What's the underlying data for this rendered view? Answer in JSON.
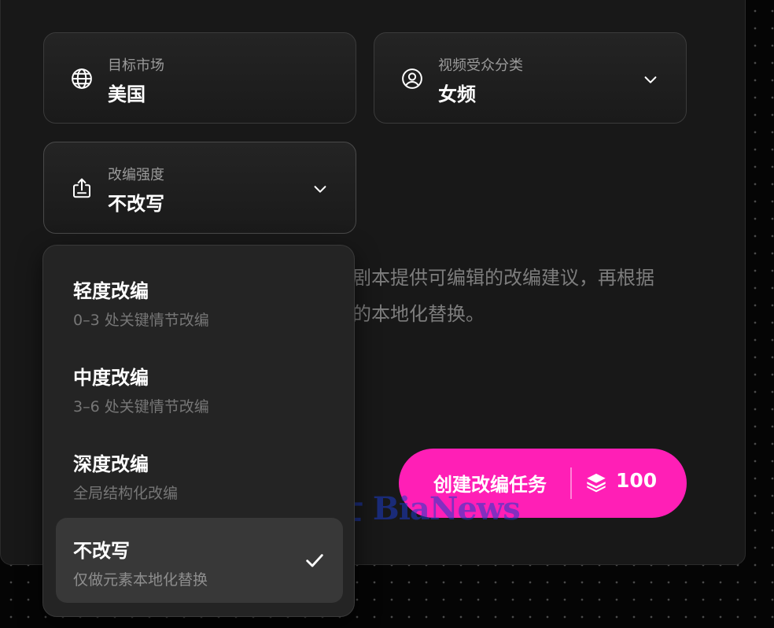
{
  "fields": {
    "market": {
      "label": "目标市场",
      "value": "美国",
      "icon": "globe-icon"
    },
    "audience": {
      "label": "视频受众分类",
      "value": "女频",
      "icon": "user-circle-icon"
    },
    "intensity": {
      "label": "改编强度",
      "value": "不改写",
      "icon": "share-upload-icon"
    }
  },
  "description": {
    "line1": "剧本提供可编辑的改编建议，再根据",
    "line2": "的本地化替换。"
  },
  "dropdown": {
    "options": [
      {
        "title": "轻度改编",
        "subtitle": "0–3 处关键情节改编",
        "selected": false
      },
      {
        "title": "中度改编",
        "subtitle": "3–6 处关键情节改编",
        "selected": false
      },
      {
        "title": "深度改编",
        "subtitle": "全局结构化改编",
        "selected": false
      },
      {
        "title": "不改写",
        "subtitle": "仅做元素本地化替换",
        "selected": true
      }
    ]
  },
  "create_button": {
    "label": "创建改编任务",
    "cost": "100",
    "icon": "coin-stack-icon",
    "color": "#ff1fb6"
  },
  "watermark": {
    "text": "鞭牛士 BiaNews"
  }
}
